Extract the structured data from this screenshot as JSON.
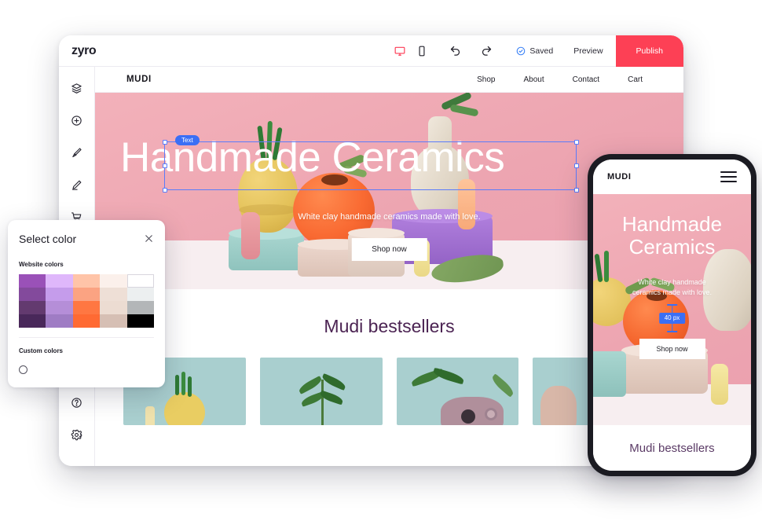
{
  "app": {
    "logo": "zyro",
    "toolbar": {
      "desktop_icon": "desktop-monitor-icon",
      "mobile_icon": "mobile-phone-icon",
      "undo_icon": "undo-arrow-icon",
      "redo_icon": "redo-arrow-icon",
      "saved_label": "Saved",
      "saved_icon": "check-circle-icon",
      "preview_label": "Preview",
      "publish_label": "Publish",
      "publish_color": "#fd4055",
      "active_device_color": "#fd3b55"
    },
    "rail": [
      {
        "name": "layers",
        "icon": "layers-icon"
      },
      {
        "name": "add-element",
        "icon": "plus-circle-icon"
      },
      {
        "name": "styles",
        "icon": "paintbrush-icon"
      },
      {
        "name": "edit",
        "icon": "pen-edit-icon"
      },
      {
        "name": "store",
        "icon": "shopping-cart-icon"
      }
    ],
    "rail_bottom": [
      {
        "name": "help",
        "icon": "question-circle-icon"
      },
      {
        "name": "settings",
        "icon": "gear-icon"
      }
    ]
  },
  "site": {
    "logo": "MUDI",
    "nav_links": [
      "Shop",
      "About",
      "Contact",
      "Cart"
    ],
    "hero": {
      "heading": "Handmade Ceramics",
      "subheading": "White clay handmade ceramics made with love.",
      "cta_label": "Shop now",
      "selection_tag": "Text"
    },
    "bestsellers": {
      "title": "Mudi bestsellers",
      "cards": [
        "product-yellow-gourd",
        "product-green-sprig",
        "product-pink-vase",
        "product-partial"
      ]
    }
  },
  "mobile_preview": {
    "logo": "MUDI",
    "menu_icon": "hamburger-menu-icon",
    "heading_line1": "Handmade",
    "heading_line2": "Ceramics",
    "subheading_line1": "White clay handmade",
    "subheading_line2": "ceramics made with love.",
    "spacing_badge": "40 px",
    "spacing_badge_color": "#3b6ff5",
    "cta_label": "Shop now",
    "bestsellers_title": "Mudi bestsellers"
  },
  "color_picker": {
    "title": "Select color",
    "close_icon": "close-x-icon",
    "website_colors_label": "Website colors",
    "custom_colors_label": "Custom colors",
    "add_custom_icon": "add-swatch-circle-icon",
    "swatches": [
      [
        "#9a51b8",
        "#dfb7fb",
        "#ffc4a8",
        "#fbf0eb",
        "#ffffff"
      ],
      [
        "#834a9c",
        "#c59ceb",
        "#fba382",
        "#eedfd6",
        "#eceff0"
      ],
      [
        "#633a6f",
        "#b58ed8",
        "#ff7742",
        "#ecdcd2",
        "#b3b6b8"
      ],
      [
        "#49285a",
        "#9f7cc4",
        "#ff6a33",
        "#d6bfb4",
        "#000000"
      ]
    ],
    "selected_swatch": {
      "row": 0,
      "col": 4
    }
  }
}
